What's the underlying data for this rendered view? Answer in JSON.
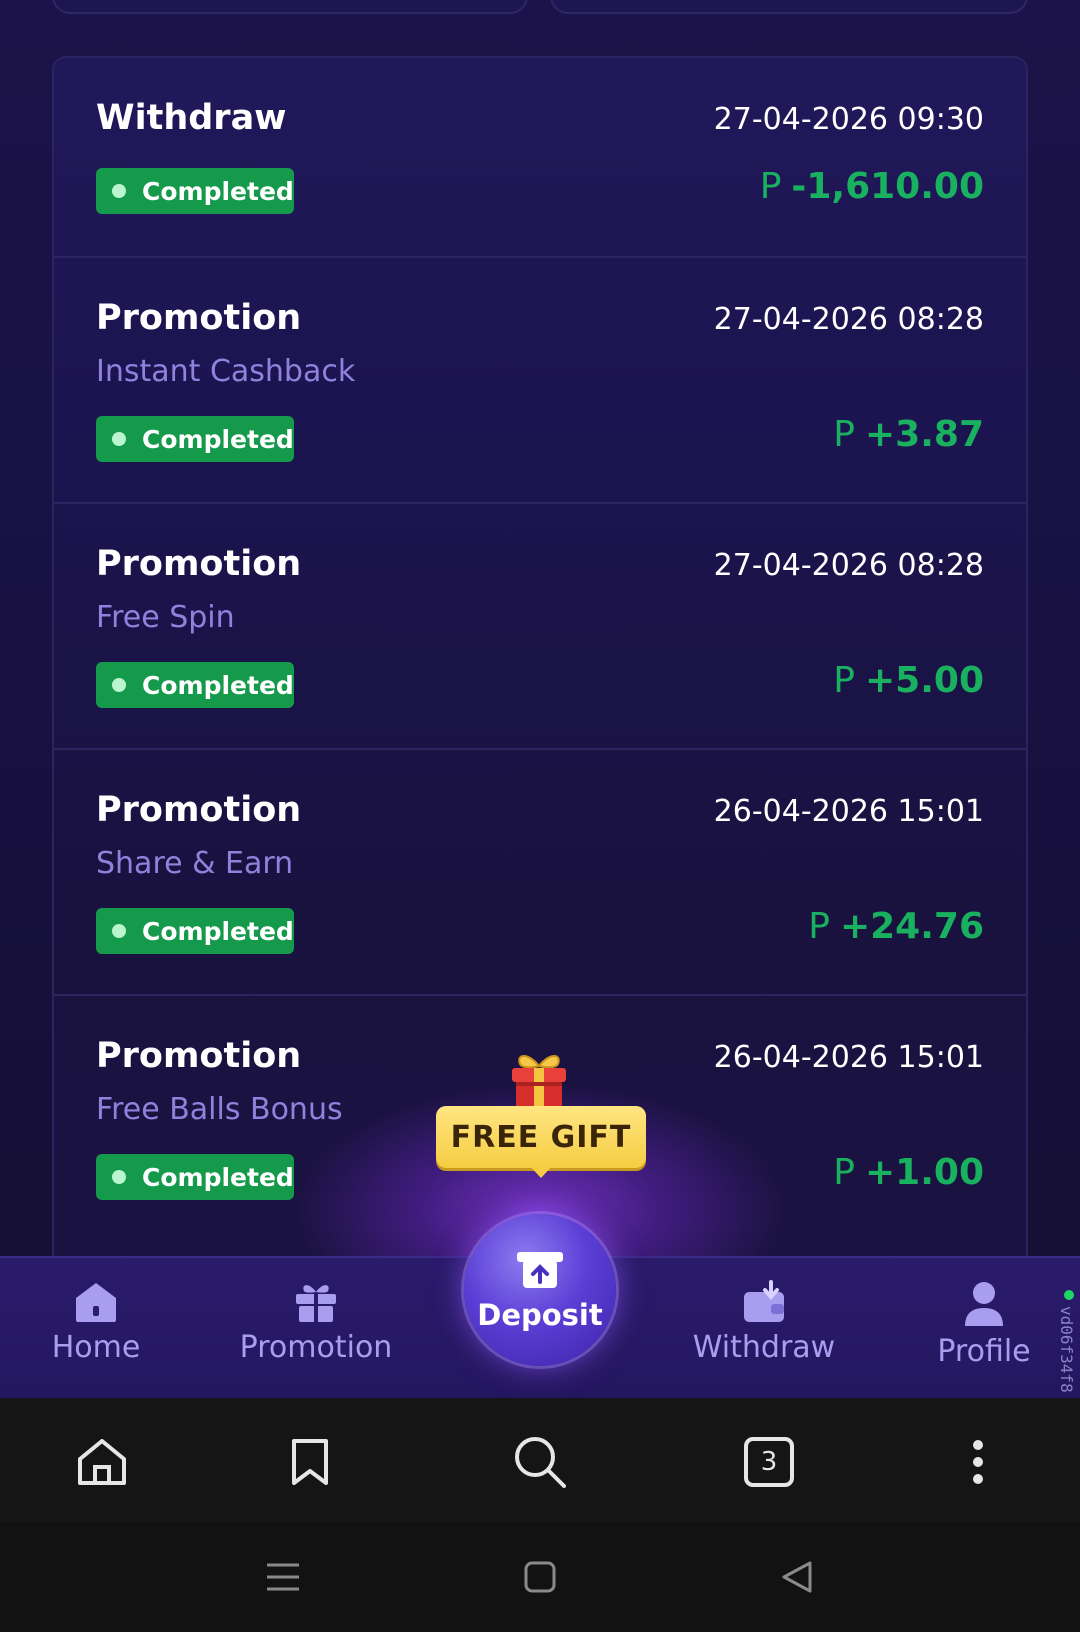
{
  "transactions": [
    {
      "type": "Withdraw",
      "date": "27-04-2026 09:30",
      "subtitle": "",
      "status": "Completed",
      "currency": "P",
      "amount": "-1,610.00"
    },
    {
      "type": "Promotion",
      "date": "27-04-2026 08:28",
      "subtitle": "Instant Cashback",
      "status": "Completed",
      "currency": "P",
      "amount": "+3.87"
    },
    {
      "type": "Promotion",
      "date": "27-04-2026 08:28",
      "subtitle": "Free Spin",
      "status": "Completed",
      "currency": "P",
      "amount": "+5.00"
    },
    {
      "type": "Promotion",
      "date": "26-04-2026 15:01",
      "subtitle": "Share & Earn",
      "status": "Completed",
      "currency": "P",
      "amount": "+24.76"
    },
    {
      "type": "Promotion",
      "date": "26-04-2026 15:01",
      "subtitle": "Free Balls Bonus",
      "status": "Completed",
      "currency": "P",
      "amount": "+1.00"
    }
  ],
  "free_gift": {
    "label": "FREE GIFT",
    "icon": "gift-box-icon"
  },
  "bottom_nav": {
    "home": {
      "label": "Home",
      "icon": "home-icon"
    },
    "promotion": {
      "label": "Promotion",
      "icon": "gift-icon"
    },
    "deposit": {
      "label": "Deposit",
      "icon": "deposit-icon"
    },
    "withdraw": {
      "label": "Withdraw",
      "icon": "wallet-icon"
    },
    "profile": {
      "label": "Profile",
      "icon": "user-icon"
    }
  },
  "version": "vd06f34f8",
  "browser": {
    "tab_count": "3"
  },
  "colors": {
    "accent_green": "#19b05f",
    "badge_green": "#159a4c",
    "nav_bg": "#2a1b6b",
    "gift_yellow": "#f6cd42"
  }
}
